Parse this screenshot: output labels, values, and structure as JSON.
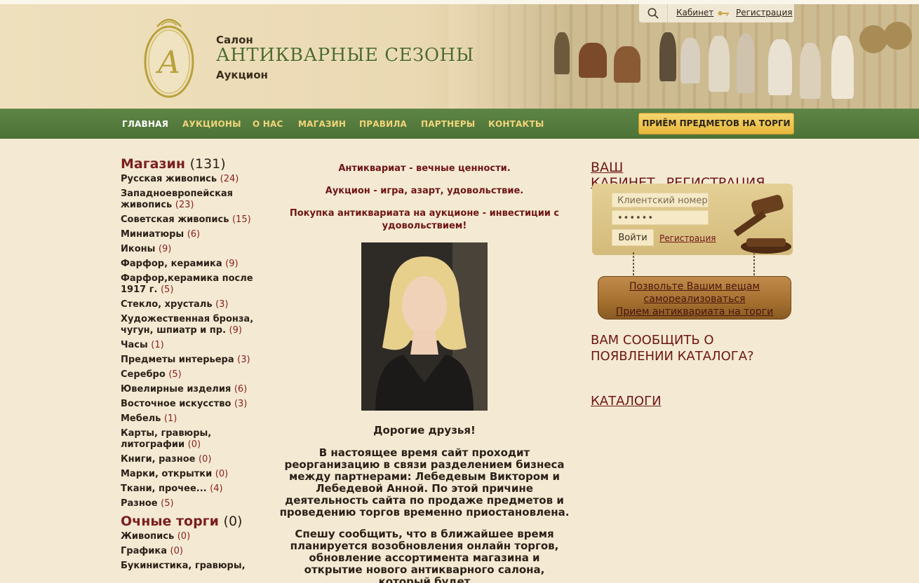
{
  "topbar": {
    "cabinet_link": "Кабинет",
    "register_link": "Регистрация"
  },
  "brand": {
    "salon": "Салон",
    "title": "АНТИКВАРНЫЕ СЕЗОНЫ",
    "auction": "Аукцион"
  },
  "nav": {
    "items": [
      "ГЛАВНАЯ",
      "АУКЦИОНЫ",
      "О НАС",
      "МАГАЗИН",
      "ПРАВИЛА",
      "ПАРТНЕРЫ",
      "КОНТАКТЫ"
    ],
    "active": "ГЛАВНАЯ",
    "cta": "ПРИЁМ ПРЕДМЕТОВ НА ТОРГИ"
  },
  "sidebar": {
    "shop": {
      "title": "Магазин",
      "count": "(131)",
      "items": [
        {
          "label": "Русская живопись",
          "count": "(24)"
        },
        {
          "label": "Западноевропейская живопись",
          "count": "(23)"
        },
        {
          "label": "Советская живопись",
          "count": "(15)"
        },
        {
          "label": "Миниатюры",
          "count": "(6)"
        },
        {
          "label": "Иконы",
          "count": "(9)"
        },
        {
          "label": "Фарфор, керамика",
          "count": "(9)"
        },
        {
          "label": "Фарфор,керамика после 1917 г.",
          "count": "(5)"
        },
        {
          "label": "Стекло, хрусталь",
          "count": "(3)"
        },
        {
          "label": "Художественная бронза, чугун, шпиатр и пр.",
          "count": "(9)"
        },
        {
          "label": "Часы",
          "count": "(1)"
        },
        {
          "label": "Предметы интерьера",
          "count": "(3)"
        },
        {
          "label": "Серебро",
          "count": "(5)"
        },
        {
          "label": "Ювелирные изделия",
          "count": "(6)"
        },
        {
          "label": "Восточное искусство",
          "count": "(3)"
        },
        {
          "label": "Мебель",
          "count": "(1)"
        },
        {
          "label": "Карты, гравюры, литографии",
          "count": "(0)"
        },
        {
          "label": "Книги, разное",
          "count": "(0)"
        },
        {
          "label": "Марки, открытки",
          "count": "(0)"
        },
        {
          "label": "Ткани, прочее...",
          "count": "(4)"
        },
        {
          "label": "Разное",
          "count": "(5)"
        }
      ]
    },
    "live": {
      "title": "Очные торги",
      "count": "(0)",
      "items": [
        {
          "label": "Живопись",
          "count": "(0)"
        },
        {
          "label": "Графика",
          "count": "(0)"
        },
        {
          "label": "Букинистика, гравюры,",
          "count": ""
        }
      ]
    }
  },
  "center": {
    "tagline1": "Антиквариат - вечные ценности.",
    "tagline2": "Аукцион - игра, азарт, удовольствие.",
    "tagline3": "Покупка антиквариата на аукционе - инвестиции с удовольствием!",
    "greeting": "Дорогие друзья!",
    "para1": "В настоящее время сайт проходит реорганизацию в связи разделением бизнеса между партнерами: Лебедевым Виктором и Лебедевой Анной. По этой причине деятельность сайта по продаже предметов и проведению торгов временно приостановлена.",
    "para2": "Спешу сообщить, что в ближайшее время планируется возобновления онлайн торгов, обновление ассортимента магазина и открытие нового антикварного салона, который будет"
  },
  "right": {
    "cabinet": "ВАШ КАБИНЕТ",
    "register": "РЕГИСТРАЦИЯ",
    "client_placeholder": "Клиентский номер",
    "password_mask": "••••••",
    "login_button": "Войти",
    "small_register": "Регистрация",
    "sign_line1": "Позвольте Вашим вещам",
    "sign_line2": "самореализоваться",
    "sign_line3": "Прием антиквариата на торги",
    "notify": "ВАМ СООБЩИТЬ О ПОЯВЛЕНИИ КАТАЛОГА?",
    "catalogs": "КАТАЛОГИ"
  }
}
